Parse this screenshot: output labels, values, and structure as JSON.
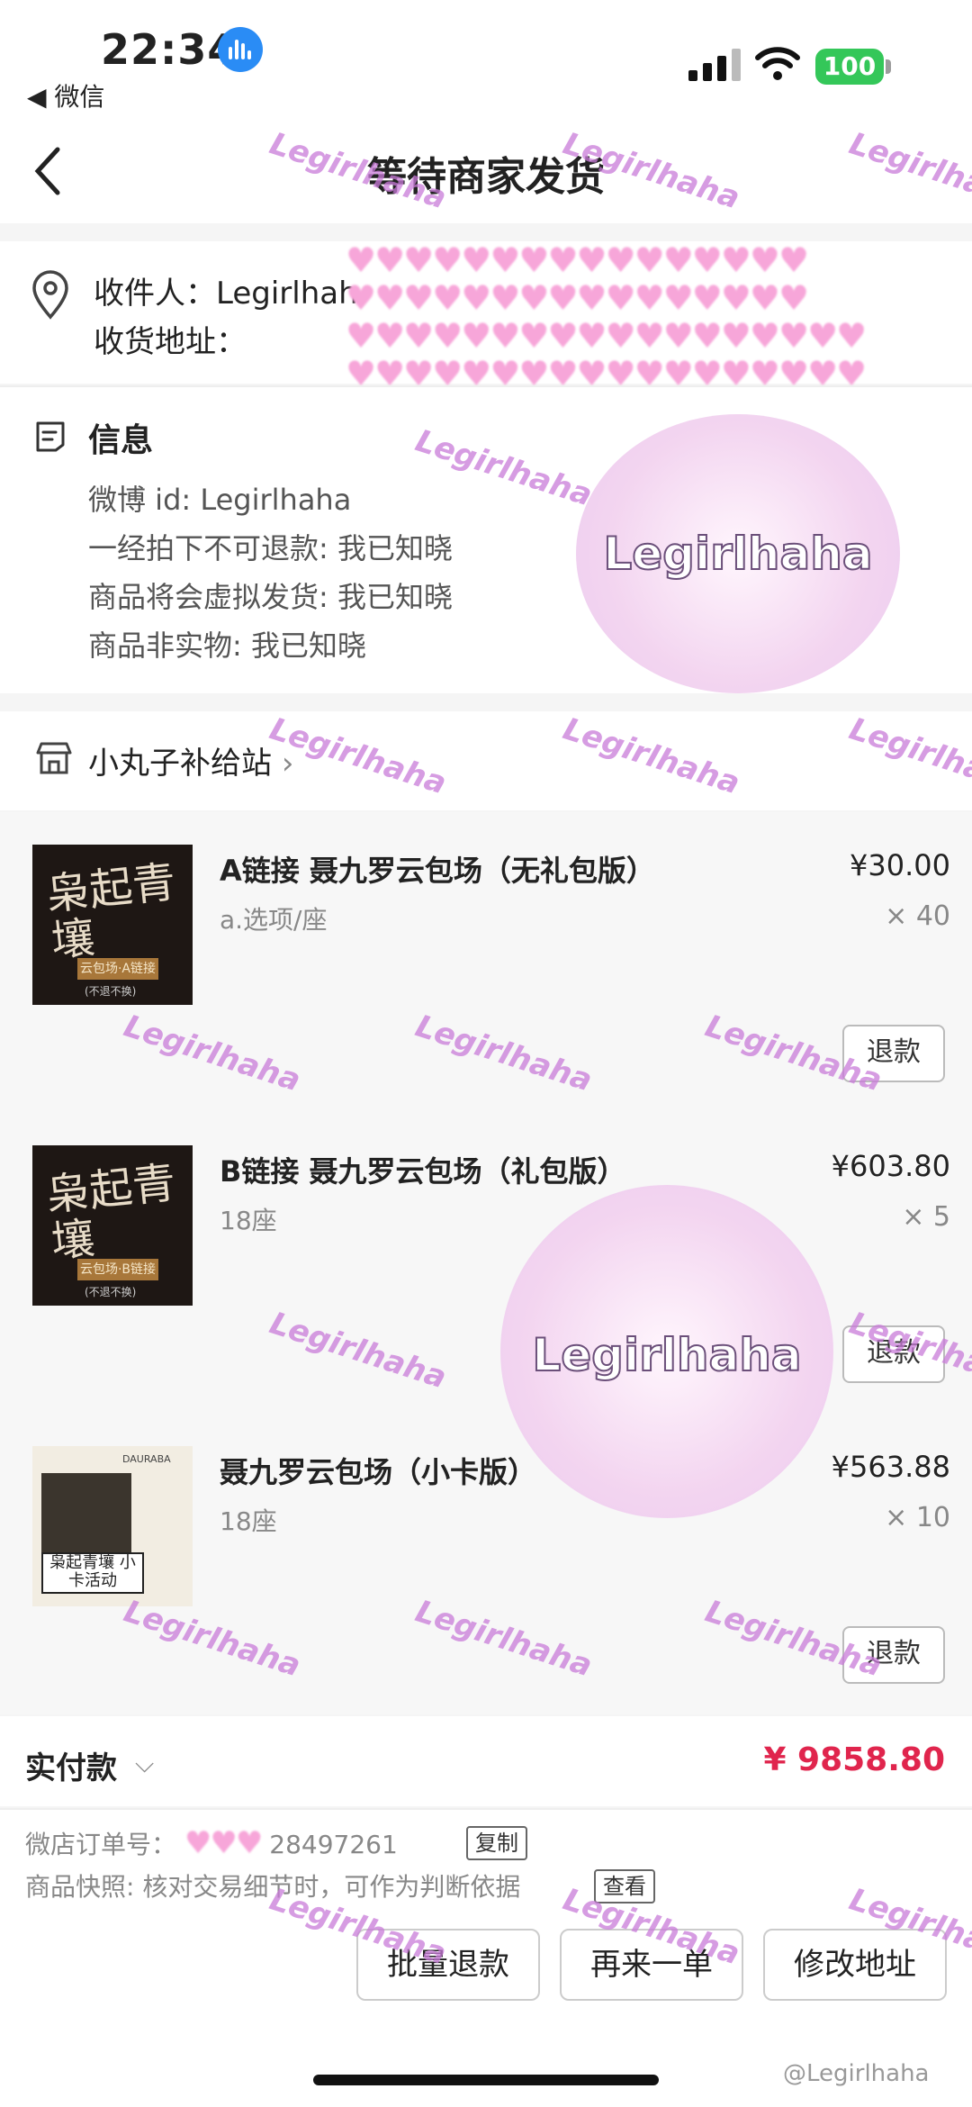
{
  "status": {
    "time": "22:34",
    "back_app": "◀ 微信",
    "battery": "100"
  },
  "nav": {
    "title": "等待商家发货"
  },
  "address": {
    "recipient_label": "收件人：",
    "recipient_name": "Legirlhah",
    "address_label": "收货地址："
  },
  "info": {
    "title": "信息",
    "lines": [
      "微博 id: Legirlhaha",
      "一经拍下不可退款: 我已知晓",
      "商品将会虚拟发货: 我已知晓",
      "商品非实物: 我已知晓"
    ]
  },
  "shop": {
    "name": "小丸子补给站",
    "chevron": "›"
  },
  "items": [
    {
      "title": "A链接 聂九罗云包场（无礼包版）",
      "spec": "a.选项/座",
      "price": "¥30.00",
      "qty": "× 40",
      "refund": "退款",
      "thumb_title": "枭起青壤",
      "thumb_tag": "云包场·A链接",
      "thumb_note": "(不退不换)"
    },
    {
      "title": "B链接 聂九罗云包场（礼包版）",
      "spec": "18座",
      "price": "¥603.80",
      "qty": "× 5",
      "refund": "退款",
      "thumb_title": "枭起青壤",
      "thumb_tag": "云包场·B链接",
      "thumb_note": "(不退不换)"
    },
    {
      "title": "聂九罗云包场（小卡版）",
      "spec": "18座",
      "price": "¥563.88",
      "qty": "× 10",
      "refund": "退款",
      "thumb_label": "枭起青壤 小卡活动",
      "thumb_brand": "DAURABA"
    }
  ],
  "total": {
    "label": "实付款",
    "chevron": "⌵",
    "price": "¥ 9858.80"
  },
  "order": {
    "number_label": "微店订单号：",
    "number_tail": "28497261",
    "copy": "复制",
    "snapshot": "商品快照: 核对交易细节时，可作为判断依据",
    "view": "查看"
  },
  "actions": {
    "batch_refund": "批量退款",
    "reorder": "再来一单",
    "edit_address": "修改地址"
  },
  "watermark": {
    "text": "Legirlhaha",
    "weibo": "@Legirlhaha"
  },
  "sticker_text": "Legirlhaha",
  "colors": {
    "price_red": "#e0254d",
    "battery_green": "#34c759",
    "watermark_purple": "#c97bd9"
  }
}
